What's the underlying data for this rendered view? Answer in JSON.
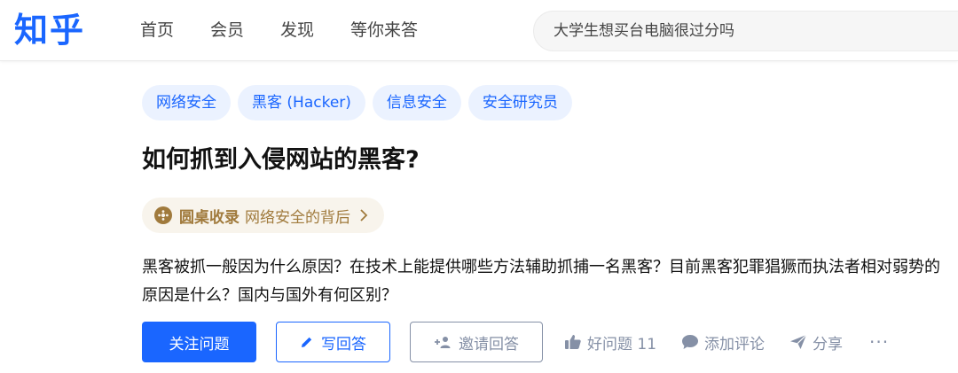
{
  "header": {
    "logo": "知乎",
    "nav": [
      "首页",
      "会员",
      "发现",
      "等你来答"
    ],
    "search_placeholder": "大学生想买台电脑很过分吗"
  },
  "question": {
    "topics": [
      "网络安全",
      "黑客 (Hacker)",
      "信息安全",
      "安全研究员"
    ],
    "title": "如何抓到入侵网站的黑客?",
    "roundtable": {
      "label": "圆桌收录",
      "text": "网络安全的背后"
    },
    "description": "黑客被抓一般因为什么原因？在技术上能提供哪些方法辅助抓捕一名黑客？目前黑客犯罪猖獗而执法者相对弱势的原因是什么？国内与国外有何区别？"
  },
  "actions": {
    "follow": "关注问题",
    "write": "写回答",
    "invite": "邀请回答",
    "good_question": "好问题 11",
    "comment": "添加评论",
    "share": "分享",
    "more": "···"
  },
  "colors": {
    "brand": "#1a66ff",
    "topic_bg": "#ebf2ff",
    "roundtable_text": "#a07a3c",
    "muted": "#8590a6"
  }
}
